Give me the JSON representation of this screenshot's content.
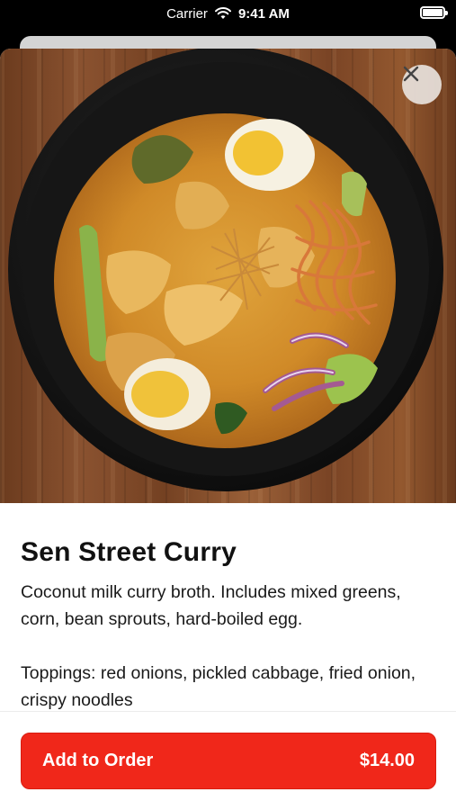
{
  "status_bar": {
    "carrier": "Carrier",
    "time": "9:41 AM"
  },
  "item": {
    "title": "Sen Street Curry",
    "description": "Coconut milk curry broth. Includes mixed greens, corn, bean sprouts, hard-boiled egg.",
    "toppings": "Toppings: red onions, pickled cabbage, fried onion, crispy noodles"
  },
  "footer": {
    "add_label": "Add to Order",
    "price": "$14.00"
  },
  "colors": {
    "accent": "#f0271a",
    "close_bg": "#e8e2dc"
  }
}
